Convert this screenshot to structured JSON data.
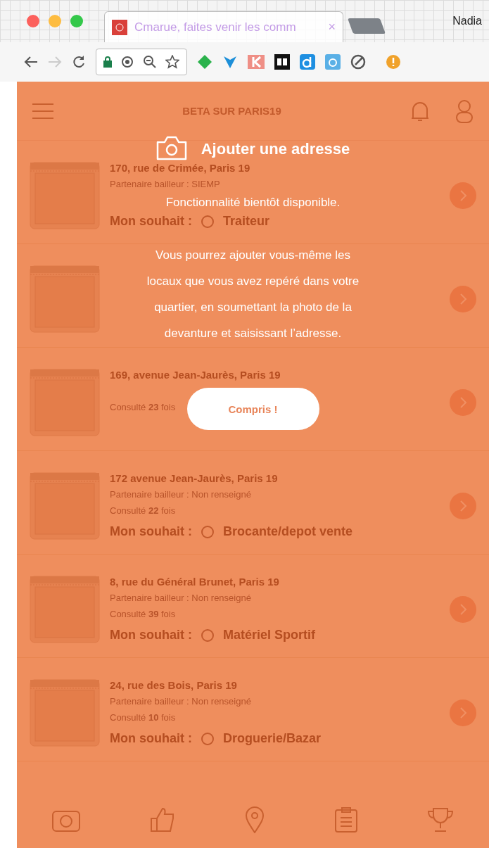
{
  "browser": {
    "tab_title": "Cmarue, faites venir les comm",
    "tab_close": "×",
    "profile": "Nadia"
  },
  "app": {
    "header_title": "BETA SUR PARIS19",
    "items": [
      {
        "kind": "entry",
        "address": "170, rue de Crimée, Paris 19",
        "partner": "Partenaire bailleur : SIEMP",
        "wish_label": "Mon souhait :",
        "wish": "Traiteur"
      },
      {
        "kind": "covered"
      },
      {
        "kind": "entry",
        "address": "169, avenue Jean-Jaurès, Paris 19",
        "views": "Consulté **23** fois"
      },
      {
        "kind": "entry",
        "address": "172 avenue Jean-Jaurès, Paris 19",
        "partner": "Partenaire bailleur : Non renseigné",
        "views": "Consulté **22** fois",
        "wish_label": "Mon souhait :",
        "wish": "Brocante/depot vente"
      },
      {
        "kind": "entry",
        "address": "8, rue du Général Brunet, Paris 19",
        "partner": "Partenaire bailleur : Non renseigné",
        "views": "Consulté **39** fois",
        "wish_label": "Mon souhait :",
        "wish": "Matériel Sportif"
      },
      {
        "kind": "entry",
        "address": "24, rue des Bois, Paris 19",
        "partner": "Partenaire bailleur : Non renseigné",
        "views": "Consulté **10** fois",
        "wish_label": "Mon souhait :",
        "wish": "Droguerie/Bazar"
      }
    ]
  },
  "modal": {
    "title": "Ajouter une adresse",
    "subtitle": "Fonctionnalité bientôt disponible.",
    "body": "Vous pourrez ajouter vous-même les locaux que vous avez repéré dans votre quartier, en soumettant la photo de la devanture et saisissant l’adresse.",
    "button": "Compris !"
  }
}
